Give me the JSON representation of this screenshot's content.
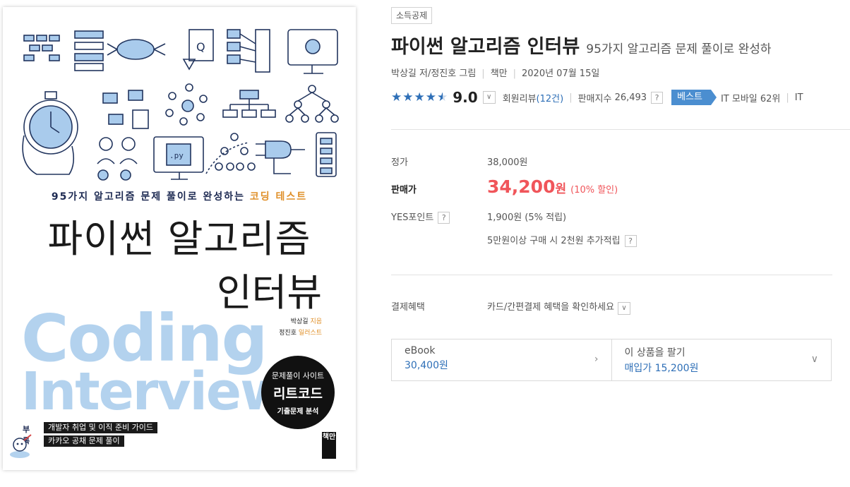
{
  "cover": {
    "subtitle_main": "95가지 알고리즘 문제 풀이로 완성하는",
    "subtitle_accent": "코딩 테스트",
    "title_line1": "파이썬 알고리즘",
    "title_line2": "인터뷰",
    "english_line1": "Coding",
    "english_line2": "Interview",
    "author1": "박상길",
    "author1_role": "지음",
    "author2": "정진호",
    "author2_role": "일러스트",
    "badge_line1": "문제풀이 사이트",
    "badge_line2": "리트코드",
    "badge_line3": "기출문제 분석",
    "appendix_label": "부록",
    "appendix_item1": "개발자 취업 및 이직 준비 가이드",
    "appendix_item2": "카카오 공채 문제 풀이",
    "publisher": "책만",
    "code_file_label": ".py"
  },
  "product": {
    "tax_badge": "소득공제",
    "title": "파이썬 알고리즘 인터뷰",
    "subtitle": "95가지 알고리즘 문제 풀이로 완성하",
    "author_line": "박상길 저/정진호 그림",
    "publisher": "책만",
    "date": "2020년 07월 15일",
    "rating_stars": 4.5,
    "score": "9.0",
    "review_label": "회원리뷰",
    "review_count": "(12건)",
    "sales_index_label": "판매지수",
    "sales_index_value": "26,493",
    "help_mark": "?",
    "best_tag": "베스트",
    "best_rank": "IT 모바일 62위",
    "best_rank_cut": "IT"
  },
  "price": {
    "list_label": "정가",
    "list_value": "38,000원",
    "sale_label": "판매가",
    "sale_value": "34,200",
    "sale_unit": "원",
    "sale_discount": "(10% 할인)",
    "points_label": "YES포인트",
    "points_value": "1,900원 (5% 적립)",
    "extra_points": "5만원이상 구매 시 2천원 추가적립",
    "payment_label": "결제혜택",
    "payment_value": "카드/간편결제 혜택을 확인하세요"
  },
  "options": {
    "ebook_label": "eBook",
    "ebook_price": "30,400원",
    "sell_label": "이 상품을 팔기",
    "sell_price": "매입가 15,200원"
  },
  "colors": {
    "accent_blue": "#2e6fb7",
    "sale_red": "#f0555a",
    "best_tag_bg": "#4b8ed0",
    "cover_light_blue": "#b3d2ee",
    "cover_orange": "#e0902a",
    "cover_navy": "#1d2a52"
  },
  "icons": {
    "star": "star-icon",
    "dropdown": "chevron-down-icon",
    "help": "question-icon",
    "chevron_right": "chevron-right-icon"
  }
}
